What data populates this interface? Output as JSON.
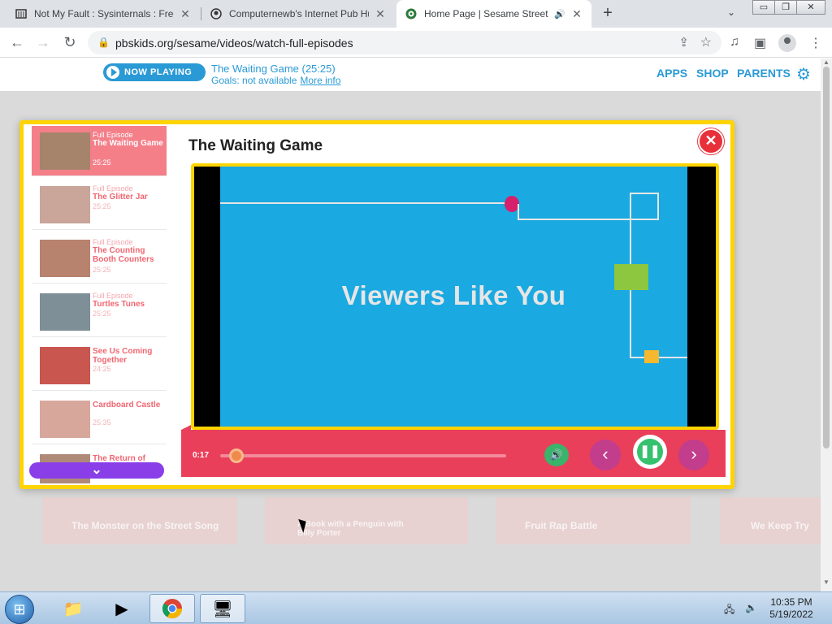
{
  "browser": {
    "tabs": [
      {
        "title": "Not My Fault : Sysinternals : Free",
        "icon": "archive-icon"
      },
      {
        "title": "Computernewb's Internet Pub Hu",
        "icon": "server-icon"
      },
      {
        "title": "Home Page | Sesame Street |",
        "icon": "pbs-kids-icon"
      }
    ],
    "url": "pbskids.org/sesame/videos/watch-full-episodes"
  },
  "header": {
    "now_playing_label": "NOW PLAYING",
    "title": "The Waiting Game (25:25)",
    "goals": "Goals: not available",
    "more_info": "More info",
    "nav": [
      "APPS",
      "SHOP",
      "PARENTS"
    ]
  },
  "modal": {
    "title": "The Waiting Game",
    "close_label": "✕",
    "playlist": [
      {
        "kicker": "Full Episode",
        "title": "The Waiting Game",
        "duration": "25:25",
        "active": true
      },
      {
        "kicker": "Full Episode",
        "title": "The Glitter Jar",
        "duration": "25:25"
      },
      {
        "kicker": "Full Episode",
        "title": "The Counting Booth Counters",
        "duration": "25:25"
      },
      {
        "kicker": "Full Episode",
        "title": "Turtles Tunes",
        "duration": "25:25"
      },
      {
        "kicker": "",
        "title": "See Us Coming Together",
        "duration": "24:25"
      },
      {
        "kicker": "",
        "title": "Cardboard Castle",
        "duration": "25:35"
      },
      {
        "kicker": "",
        "title": "The Return of",
        "duration": ""
      }
    ],
    "video_text": "Viewers Like You",
    "time": "0:17",
    "progress": 0.02
  },
  "background_cards": [
    "The Monster on the Street Song",
    "A Book with a Penguin with Billy Porter",
    "Fruit Rap Battle",
    "We Keep Try"
  ],
  "taskbar": {
    "time": "10:35 PM",
    "date": "5/19/2022"
  },
  "colors": {
    "pbs_blue": "#2a9ad6",
    "modal_border": "#ffd400",
    "controls_red": "#ea3f5a",
    "video_blue": "#1aa9e1"
  }
}
